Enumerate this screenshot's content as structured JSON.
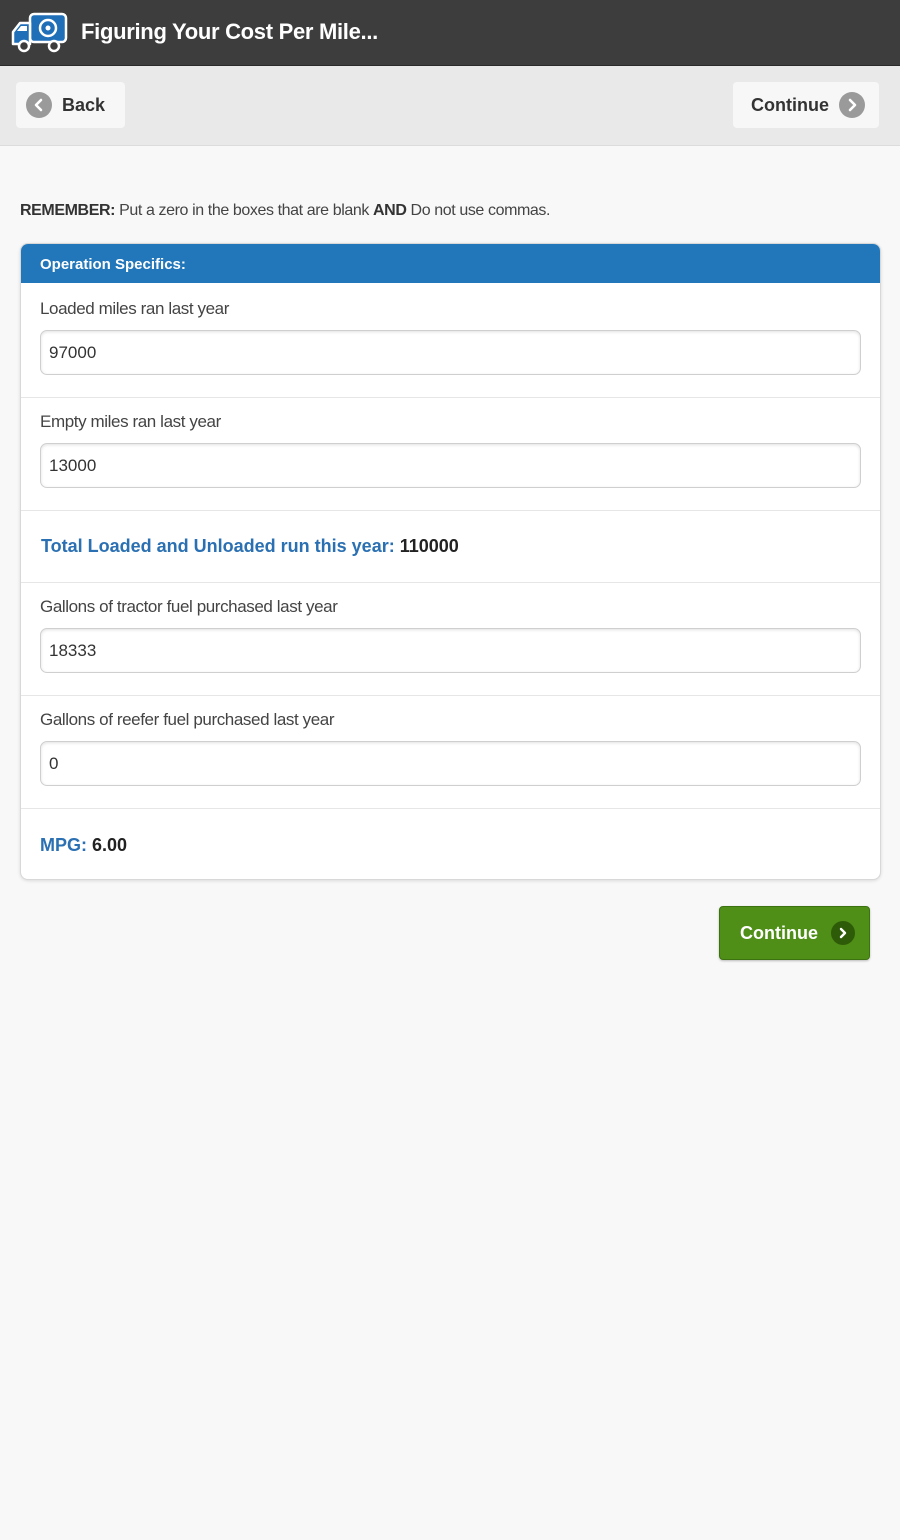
{
  "app": {
    "title": "Figuring Your Cost Per Mile..."
  },
  "toolbar": {
    "back_label": "Back",
    "continue_label": "Continue"
  },
  "notice": {
    "remember_label": "REMEMBER:",
    "text_1": " Put a zero in the boxes that are blank ",
    "and_label": "AND",
    "text_2": " Do not use commas."
  },
  "panel": {
    "header": "Operation Specifics:",
    "loaded_miles": {
      "label": "Loaded miles ran last year",
      "value": "97000"
    },
    "empty_miles": {
      "label": "Empty miles ran last year",
      "value": "13000"
    },
    "total": {
      "label": "Total Loaded and Unloaded run this year:",
      "value": "110000"
    },
    "tractor_fuel": {
      "label": "Gallons of tractor fuel purchased last year",
      "value": "18333"
    },
    "reefer_fuel": {
      "label": "Gallons of reefer fuel purchased last year",
      "value": "0"
    },
    "mpg": {
      "label": "MPG:",
      "value": "6.00"
    }
  },
  "footer": {
    "continue_label": "Continue"
  },
  "colors": {
    "header_bar": "#3d3d3d",
    "panel_header": "#2277bb",
    "label_blue": "#2a70b2",
    "continue_green": "#4f8f17"
  },
  "icons": [
    "truck-logo-icon",
    "chevron-left-icon",
    "chevron-right-icon"
  ]
}
